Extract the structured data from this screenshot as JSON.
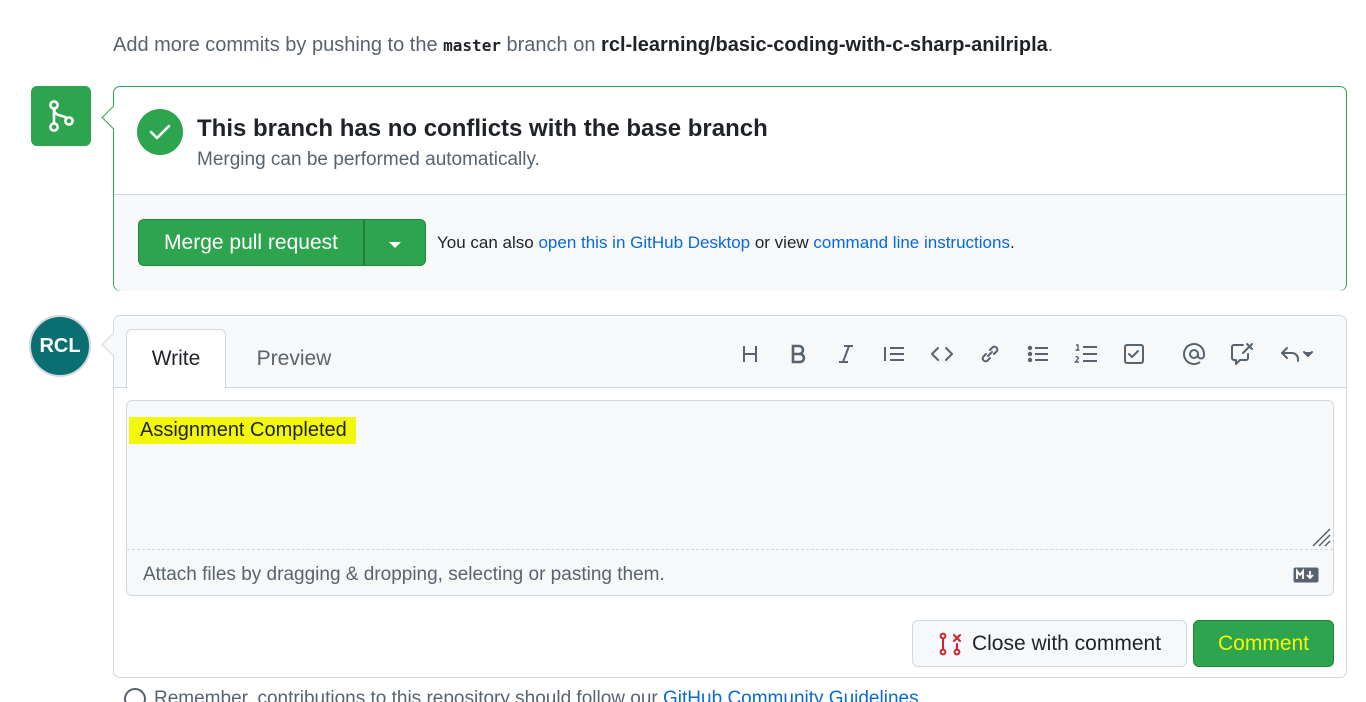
{
  "hint": {
    "prefix": "Add more commits by pushing to the ",
    "branch": "master",
    "middle": " branch on ",
    "repo": "rcl-learning/basic-coding-with-c-sharp-anilripla",
    "suffix": "."
  },
  "merge": {
    "title": "This branch has no conflicts with the base branch",
    "subtitle": "Merging can be performed automatically.",
    "button_label": "Merge pull request",
    "note_prefix": "You can also ",
    "desktop_link": "open this in GitHub Desktop",
    "note_middle": " or view ",
    "cli_link": "command line instructions",
    "note_suffix": "."
  },
  "comment": {
    "avatar_text": "RCL",
    "tabs": {
      "write": "Write",
      "preview": "Preview"
    },
    "toolbar": [
      "heading-icon",
      "bold-icon",
      "italic-icon",
      "quote-icon",
      "code-icon",
      "link-icon",
      "unordered-list-icon",
      "ordered-list-icon",
      "task-list-icon",
      "mention-icon",
      "reference-icon",
      "reply-icon"
    ],
    "text": "Assignment Completed",
    "attach_hint": "Attach files by dragging & dropping, selecting or pasting them.",
    "close_button": "Close with comment",
    "comment_button": "Comment"
  },
  "footer": {
    "text": "Remember, contributions to this repository should follow our ",
    "link": "GitHub Community Guidelines"
  },
  "colors": {
    "accent_green": "#2da44e",
    "link_blue": "#0969da",
    "highlight_yellow": "#f3f80a"
  }
}
